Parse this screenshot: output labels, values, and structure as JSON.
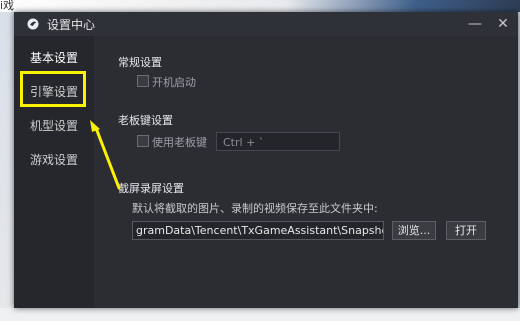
{
  "background": {
    "top_text": "i戏"
  },
  "window": {
    "title": "设置中心",
    "minimize_glyph": "—",
    "close_glyph": "✕"
  },
  "sidebar": {
    "items": [
      {
        "label": "基本设置",
        "active": true
      },
      {
        "label": "引擎设置",
        "active": false
      },
      {
        "label": "机型设置",
        "active": false
      },
      {
        "label": "游戏设置",
        "active": false
      }
    ]
  },
  "general": {
    "title": "常规设置",
    "autostart_label": "开机启动",
    "autostart_checked": false
  },
  "boss_key": {
    "title": "老板键设置",
    "enable_label": "使用老板键",
    "enable_checked": false,
    "hotkey_value": "Ctrl + `"
  },
  "screenshot": {
    "title": "截屏录屏设置",
    "description": "默认将截取的图片、录制的视频保存至此文件夹中:",
    "path_value": "gramData\\Tencent\\TxGameAssistant\\Snapshot",
    "browse_label": "浏览...",
    "open_label": "打开"
  },
  "annotation": {
    "color": "#fbf102"
  },
  "colors": {
    "dialog_bg": "#2b2d33",
    "sidebar_bg": "#25272c",
    "highlight": "#fbf102"
  }
}
